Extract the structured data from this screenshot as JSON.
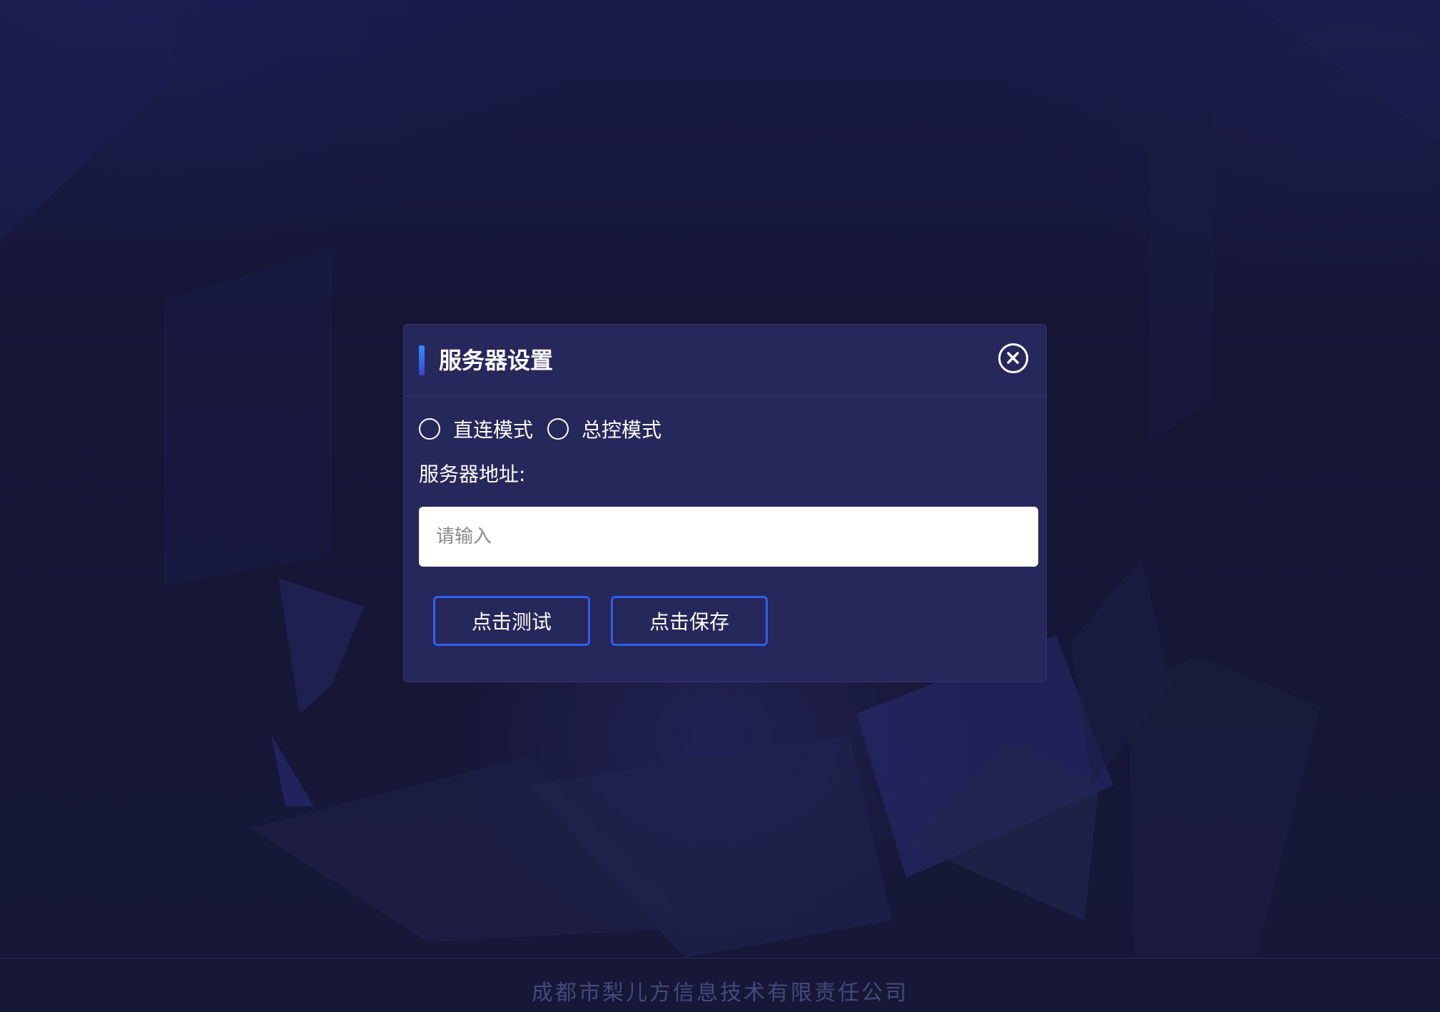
{
  "dialog": {
    "title": "服务器设置",
    "modes": [
      {
        "label": "直连模式",
        "selected": false
      },
      {
        "label": "总控模式",
        "selected": false
      }
    ],
    "server_address_label": "服务器地址:",
    "server_address": {
      "value": "",
      "placeholder": "请输入"
    },
    "test_button": "点击测试",
    "save_button": "点击保存"
  },
  "footer": {
    "company": "成都市梨儿方信息技术有限责任公司"
  },
  "colors": {
    "background": "#161736",
    "dialog_bg": "#26275a",
    "accent": "#2f5ff0",
    "footer_text": "#45487a"
  },
  "icons": {
    "close": "close-icon",
    "title_accent": "title-accent-bar"
  }
}
